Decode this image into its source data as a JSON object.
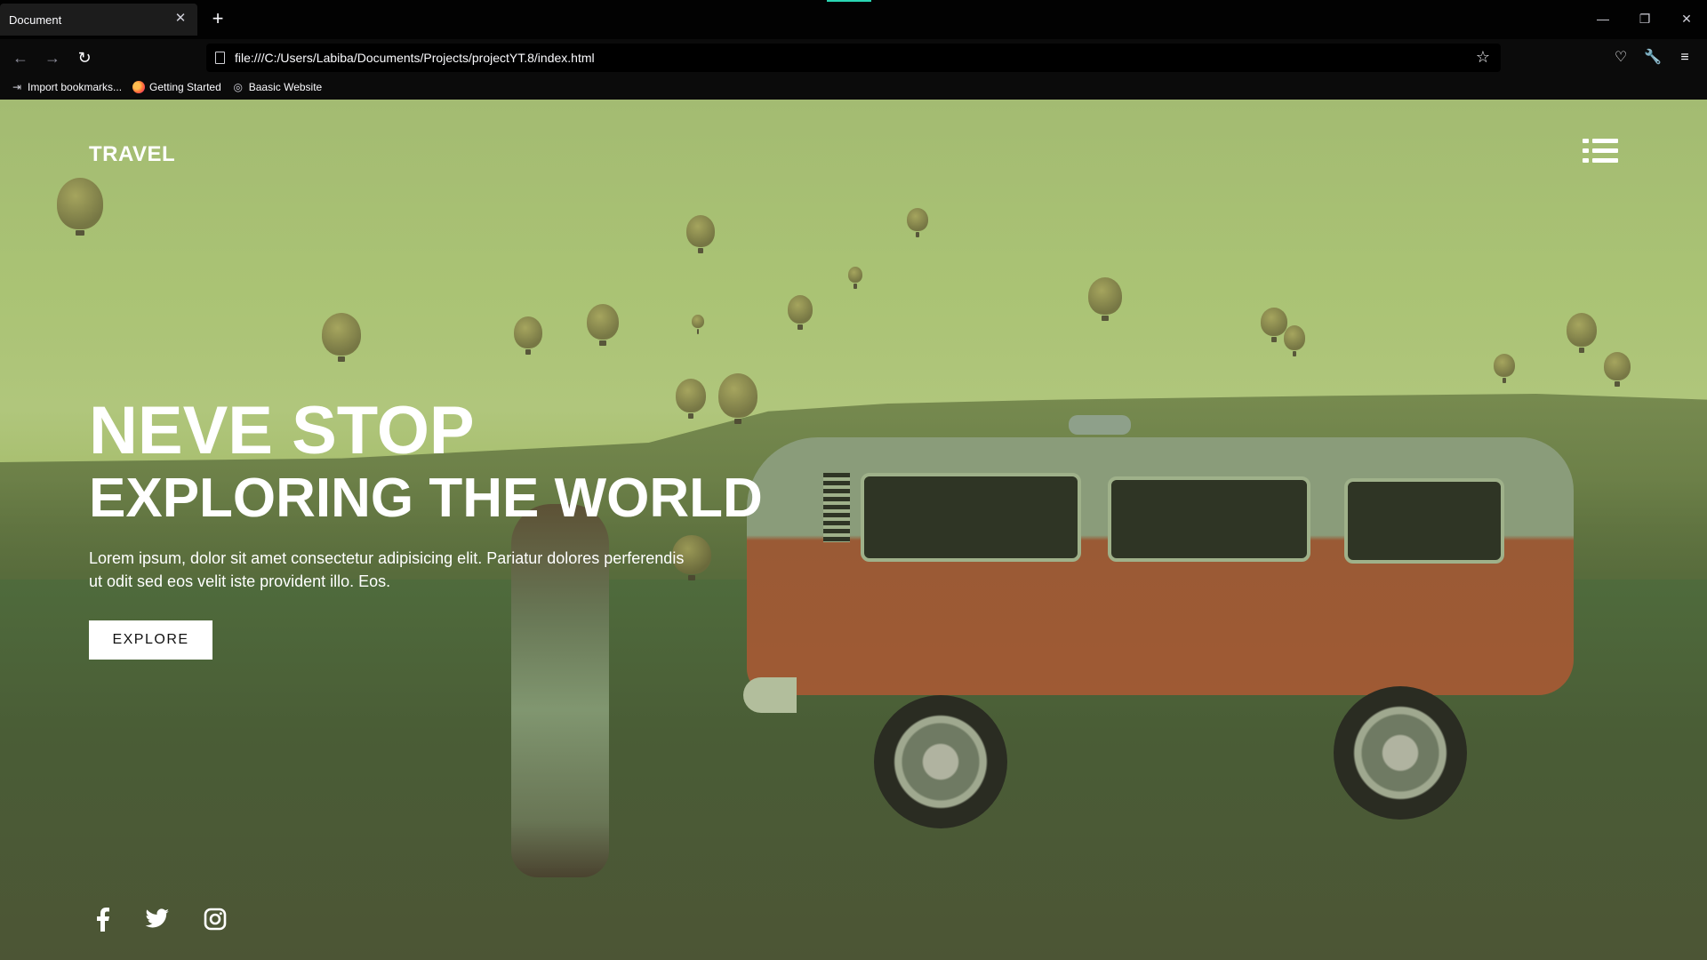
{
  "browser": {
    "tab_title": "Document",
    "tab_close_icon": "close-icon",
    "new_tab_label": "+",
    "url": "file:///C:/Users/Labiba/Documents/Projects/projectYT.8/index.html",
    "bookmarks": [
      {
        "label": "Import bookmarks...",
        "icon": "import-icon"
      },
      {
        "label": "Getting Started",
        "icon": "firefox-icon"
      },
      {
        "label": "Baasic Website",
        "icon": "globe-icon"
      }
    ]
  },
  "page": {
    "brand": "TRAVEL",
    "headline_line1": "NEVE STOP",
    "headline_line2": "EXPLORING THE WORLD",
    "paragraph": "Lorem ipsum, dolor sit amet consectetur adipisicing elit. Pariatur dolores perferendis ut odit sed eos velit iste provident illo. Eos.",
    "cta_label": "EXPLORE",
    "social_icons": [
      "facebook-icon",
      "twitter-icon",
      "instagram-icon"
    ]
  },
  "colors": {
    "chrome_bg": "#020202",
    "tab_bg": "#1c1c1c",
    "hero_tint": "#a3bb72",
    "text_white": "#ffffff",
    "van_orange": "#9f5a34"
  }
}
